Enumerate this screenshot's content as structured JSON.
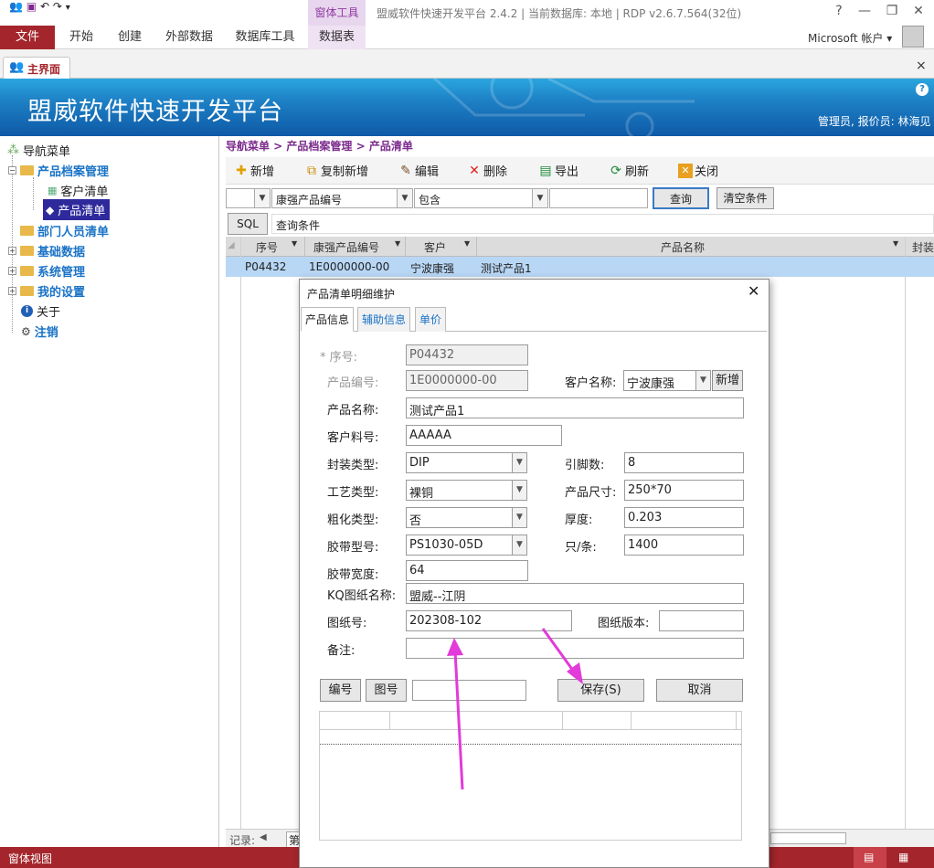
{
  "window": {
    "app_title": "盟威软件快速开发平台 2.4.2 | 当前数据库: 本地 | RDP v2.6.7.564(32位)",
    "context_tab_group": "窗体工具",
    "help": "?",
    "minimize": "—",
    "restore": "❐",
    "close": "✕",
    "account": "Microsoft 帐户"
  },
  "ribbon": {
    "tabs": [
      "文件",
      "开始",
      "创建",
      "外部数据",
      "数据库工具",
      "数据表"
    ]
  },
  "doc_tab": {
    "label": "主界面",
    "close": "×"
  },
  "banner": {
    "title": "盟威软件快速开发平台",
    "user_info": "管理员, 报价员: 林海见"
  },
  "nav": {
    "root": "导航菜单",
    "items": [
      {
        "label": "产品档案管理",
        "level": 1
      },
      {
        "label": "客户清单",
        "level": 2
      },
      {
        "label": "产品清单",
        "level": 2
      },
      {
        "label": "部门人员清单",
        "level": 1
      },
      {
        "label": "基础数据",
        "level": 1
      },
      {
        "label": "系统管理",
        "level": 1
      },
      {
        "label": "我的设置",
        "level": 1
      },
      {
        "label": "关于",
        "level": 1
      },
      {
        "label": "注销",
        "level": 1
      }
    ]
  },
  "breadcrumb": "导航菜单 > 产品档案管理 > 产品清单",
  "toolbar": {
    "new": "新增",
    "copy_new": "复制新增",
    "edit": "编辑",
    "delete": "删除",
    "export": "导出",
    "refresh": "刷新",
    "close": "关闭"
  },
  "filter": {
    "field": "康强产品编号",
    "operator": "包含",
    "value": "",
    "query": "查询",
    "clear": "清空条件",
    "sql": "SQL",
    "condition_label": "查询条件"
  },
  "grid": {
    "headers": [
      "序号",
      "康强产品编号",
      "客户",
      "产品名称",
      "封装"
    ],
    "rows": [
      [
        "P04432",
        "1E0000000-00",
        "宁波康强",
        "测试产品1"
      ]
    ]
  },
  "record_bar": {
    "label": "记录:",
    "nav": "◀",
    "current": "第"
  },
  "status": {
    "text": "窗体视图"
  },
  "dialog": {
    "title": "产品清单明细维护",
    "close": "✕",
    "tabs": [
      "产品信息",
      "辅助信息",
      "单价"
    ],
    "fields": {
      "seq_label": "* 序号:",
      "seq": "P04432",
      "code_label": "产品编号:",
      "code": "1E0000000-00",
      "customer_label": "客户名称:",
      "customer": "宁波康强",
      "customer_new": "新增",
      "name_label": "产品名称:",
      "name": "测试产品1",
      "cust_part_label": "客户料号:",
      "cust_part": "AAAAA",
      "package_label": "封装类型:",
      "package": "DIP",
      "pins_label": "引脚数:",
      "pins": "8",
      "process_label": "工艺类型:",
      "process": "裸铜",
      "size_label": "产品尺寸:",
      "size": "250*70",
      "rough_label": "粗化类型:",
      "rough": "否",
      "thick_label": "厚度:",
      "thick": "0.203",
      "tape_model_label": "胶带型号:",
      "tape_model": "PS1030-05D",
      "per_strip_label": "只/条:",
      "per_strip": "1400",
      "tape_width_label": "胶带宽度:",
      "tape_width": "64",
      "kq_drawing_label": "KQ图纸名称:",
      "kq_drawing": "盟威--江阴",
      "drawing_no_label": "图纸号:",
      "drawing_no": "202308-102",
      "drawing_ver_label": "图纸版本:",
      "drawing_ver": "",
      "remark_label": "备注:",
      "remark": ""
    },
    "buttons": {
      "code": "编号",
      "drawing": "图号",
      "save": "保存(S)",
      "cancel": "取消"
    },
    "search_value": ""
  },
  "colors": {
    "accent": "#a4262c",
    "banner": "#1d7fc4",
    "highlight_row": "#b8d7f5",
    "arrow": "#e23bd9"
  }
}
